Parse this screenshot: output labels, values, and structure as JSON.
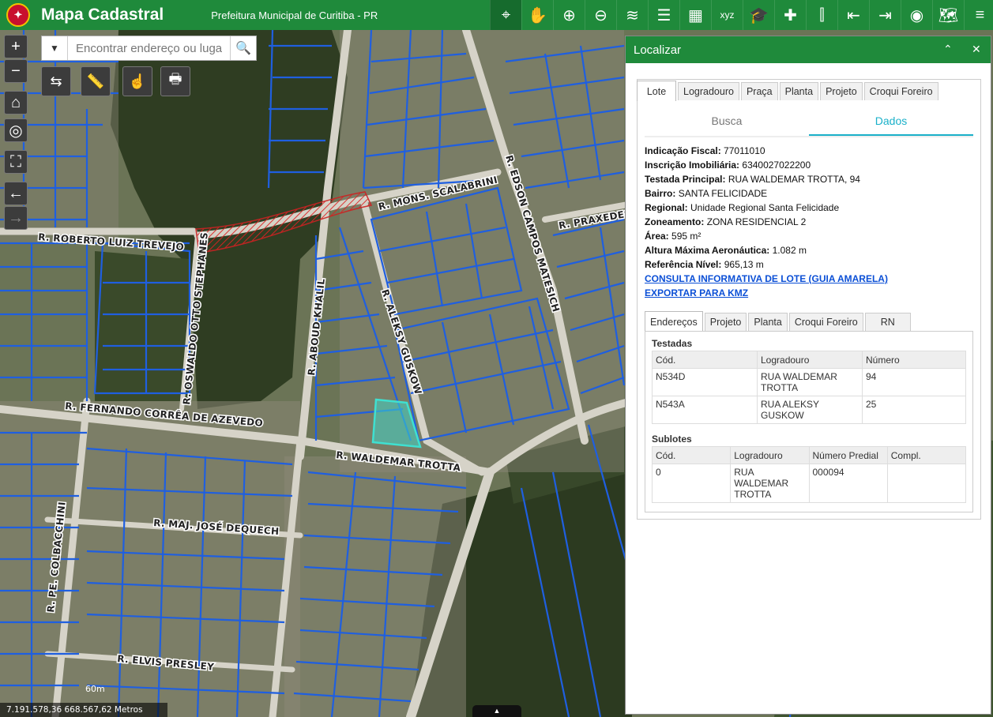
{
  "header": {
    "title": "Mapa Cadastral",
    "subtitle": "Prefeitura Municipal de Curitiba - PR",
    "tools": [
      {
        "icon": "identify-icon",
        "glyph": "⌖",
        "active": true
      },
      {
        "icon": "pan-hand-icon",
        "glyph": "✋"
      },
      {
        "icon": "zoom-in-icon",
        "glyph": "⊕"
      },
      {
        "icon": "zoom-out-icon",
        "glyph": "⊖"
      },
      {
        "icon": "layers-add-icon",
        "glyph": "≋"
      },
      {
        "icon": "legend-list-icon",
        "glyph": "☰"
      },
      {
        "icon": "grid-icon",
        "glyph": "▦"
      },
      {
        "icon": "xyz-coordinates-icon",
        "glyph": "xyz"
      },
      {
        "icon": "education-cap-icon",
        "glyph": "🎓"
      },
      {
        "icon": "add-layer-puzzle-icon",
        "glyph": "✚"
      },
      {
        "icon": "split-compare-icon",
        "glyph": "⫿"
      },
      {
        "icon": "import-icon",
        "glyph": "⇤"
      },
      {
        "icon": "export-icon",
        "glyph": "⇥"
      },
      {
        "icon": "location-target-icon",
        "glyph": "◉"
      },
      {
        "icon": "basemap-icon",
        "glyph": "🗺"
      },
      {
        "icon": "menu-icon",
        "glyph": "≡"
      }
    ]
  },
  "search": {
    "placeholder": "Encontrar endereço ou luga",
    "dropdown_glyph": "▼",
    "search_glyph": "🔍"
  },
  "map_controls": {
    "zoom_in": "+",
    "zoom_out": "−",
    "home": "⌂",
    "locate": "◎",
    "fullscreen": "⛶",
    "back": "←",
    "forward": "→"
  },
  "map_tools": [
    {
      "name": "measure-area-icon",
      "glyph": "⇆"
    },
    {
      "name": "ruler-icon",
      "glyph": "📏"
    },
    {
      "name": "identify-click-icon",
      "glyph": "☝"
    },
    {
      "name": "print-icon",
      "glyph": "🖶"
    }
  ],
  "streets": [
    "R. ROBERTO LUIZ TREVEJO",
    "R. MONS. SCALABRINI",
    "R. EDSON CAMPOS MATESICH",
    "R. PRAXEDES S",
    "R. OSWALDO OTTO STEPHANES",
    "R. ABOUD KHALIL",
    "R. ALEKSY GUSKOW",
    "R. FERNANDO CORRÊA DE AZEVEDO",
    "R. WALDEMAR TROTTA",
    "R. MAJ. JOSÉ DEQUECH",
    "R. PE. COLBACCHINI",
    "R. ELVIS PRESLEY"
  ],
  "scale": "60m",
  "coordinates": "7.191.578,36 668.567,62 Metros",
  "bottom_handle": "▲",
  "panel": {
    "title": "Localizar",
    "collapse_glyph": "⌃",
    "close_glyph": "✕",
    "tabs": [
      "Lote",
      "Logradouro",
      "Praça",
      "Planta",
      "Projeto",
      "Croqui Foreiro"
    ],
    "subtabs": [
      "Busca",
      "Dados"
    ],
    "fields": [
      {
        "label": "Indicação Fiscal:",
        "value": "77011010"
      },
      {
        "label": "Inscrição Imobiliária:",
        "value": "6340027022200"
      },
      {
        "label": "Testada Principal:",
        "value": "RUA WALDEMAR TROTTA, 94"
      },
      {
        "label": "Bairro:",
        "value": "SANTA FELICIDADE"
      },
      {
        "label": "Regional:",
        "value": "Unidade Regional Santa Felicidade"
      },
      {
        "label": "Zoneamento:",
        "value": "ZONA RESIDENCIAL 2"
      },
      {
        "label": "Área:",
        "value": "595 m²"
      },
      {
        "label": "Altura Máxima Aeronáutica:",
        "value": "1.082 m"
      },
      {
        "label": "Referência Nível:",
        "value": "965,13 m"
      }
    ],
    "links": [
      "CONSULTA INFORMATIVA DE LOTE (GUIA AMARELA)",
      "EXPORTAR PARA KMZ"
    ],
    "tabs2": [
      "Endereços",
      "Projeto",
      "Planta",
      "Croqui Foreiro",
      "RN"
    ],
    "testadas": {
      "title": "Testadas",
      "headers": [
        "Cód.",
        "Logradouro",
        "Número"
      ],
      "rows": [
        [
          "N534D",
          "RUA WALDEMAR TROTTA",
          "94"
        ],
        [
          "N543A",
          "RUA ALEKSY GUSKOW",
          "25"
        ]
      ]
    },
    "sublotes": {
      "title": "Sublotes",
      "headers": [
        "Cód.",
        "Logradouro",
        "Número Predial",
        "Compl."
      ],
      "rows": [
        [
          "0",
          "RUA WALDEMAR TROTTA",
          "000094",
          ""
        ]
      ]
    }
  }
}
